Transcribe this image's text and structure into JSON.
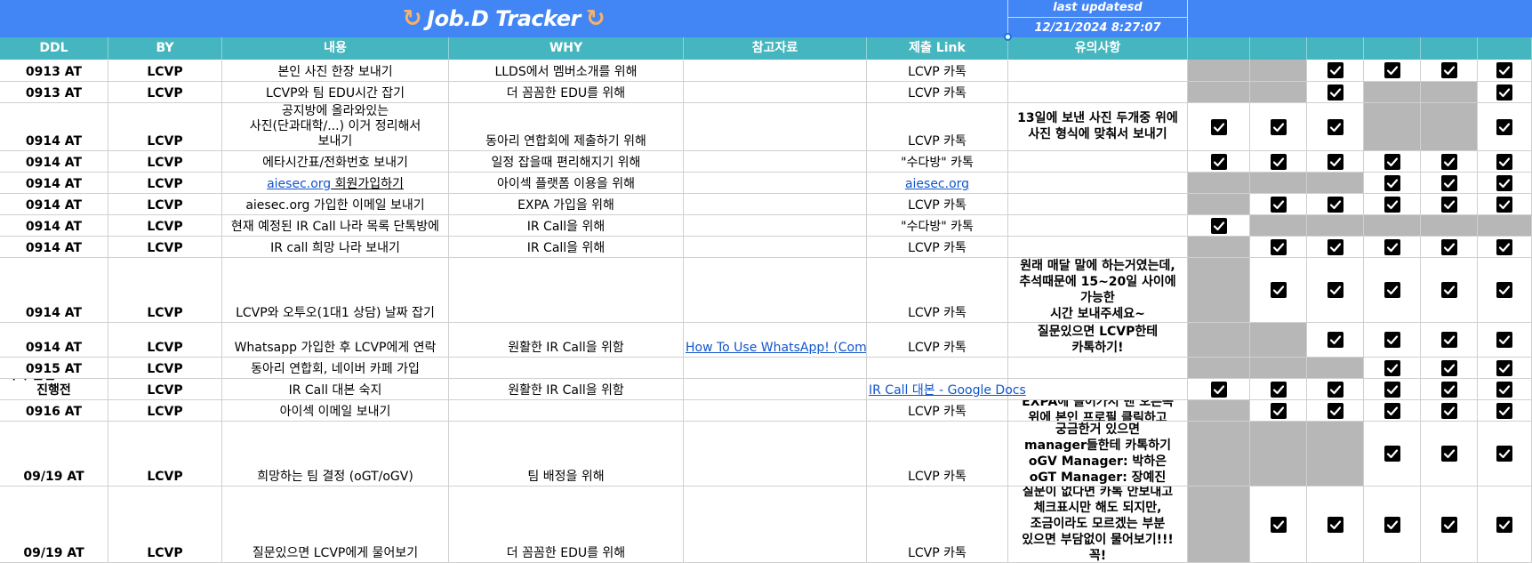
{
  "banner": {
    "title": "Job.D Tracker",
    "title_icon": "swirl-arrow-icon",
    "updated_label": "last updatesd",
    "updated_value": "12/21/2024 8:27:07"
  },
  "colors": {
    "banner": "#4285f4",
    "header": "#45b6bf",
    "gray_cell": "#b7b7b7",
    "link": "#1155cc"
  },
  "columns": [
    "DDL",
    "BY",
    "내용",
    "WHY",
    "참고자료",
    "제출 Link",
    "유의사항",
    "",
    "",
    "",
    "",
    "",
    ""
  ],
  "rows": [
    {
      "ddl": "0913 AT",
      "by": "LCVP",
      "content": "본인 사진 한장 보내기",
      "why": "LLDS에서 멤버소개를 위해",
      "ref": "",
      "link": "LCVP 카톡",
      "note": "",
      "checks": [
        "gray",
        "gray",
        "check",
        "check",
        "check",
        "check"
      ]
    },
    {
      "ddl": "0913 AT",
      "by": "LCVP",
      "content": "LCVP와 팀 EDU시간 잡기",
      "why": "더 꼼꼼한 EDU를 위해",
      "ref": "",
      "link": "LCVP 카톡",
      "note": "",
      "checks": [
        "gray",
        "gray",
        "check",
        "gray",
        "gray",
        "check"
      ]
    },
    {
      "ddl": "0914 AT",
      "by": "LCVP",
      "content": "공지방에 올라와있는\n사진(단과대학/...) 이거 정리해서\n보내기",
      "why": "동아리 연합회에 제출하기 위해",
      "ref": "",
      "link": "LCVP 카톡",
      "note": "13일에 보낸 사진 두개중 위에\n사진 형식에 맞춰서 보내기",
      "checks": [
        "check",
        "check",
        "check",
        "gray",
        "gray",
        "check"
      ]
    },
    {
      "ddl": "0914 AT",
      "by": "LCVP",
      "content": "에타시간표/전화번호 보내기",
      "why": "일정 잡을때 편리해지기 위해",
      "ref": "",
      "link": "\"수다방\" 카톡",
      "note": "",
      "checks": [
        "check",
        "check",
        "check",
        "check",
        "check",
        "check"
      ]
    },
    {
      "ddl": "0914 AT",
      "by": "LCVP",
      "content_link": "aiesec.org",
      "content": " 회원가입하기",
      "why": "아이섹 플랫폼 이용을 위해",
      "ref": "",
      "link_url": "aiesec.org",
      "link": "",
      "note": "",
      "checks": [
        "gray",
        "gray",
        "gray",
        "check",
        "check",
        "check"
      ]
    },
    {
      "ddl": "0914 AT",
      "by": "LCVP",
      "content": "aiesec.org 가입한 이메일 보내기",
      "why": "EXPA 가입을 위해",
      "ref": "",
      "link": "LCVP 카톡",
      "note": "",
      "checks": [
        "gray",
        "check",
        "check",
        "check",
        "check",
        "check"
      ]
    },
    {
      "ddl": "0914 AT",
      "by": "LCVP",
      "content": "현재 예정된 IR Call 나라 목록 단톡방에",
      "why": "IR Call을 위해",
      "ref": "",
      "link": "\"수다방\" 카톡",
      "note": "",
      "checks": [
        "check",
        "gray",
        "gray",
        "gray",
        "gray",
        "gray"
      ]
    },
    {
      "ddl": "0914 AT",
      "by": "LCVP",
      "content": "IR call 희망 나라 보내기",
      "why": "IR Call을 위해",
      "ref": "",
      "link": "LCVP 카톡",
      "note": "",
      "checks": [
        "gray",
        "check",
        "check",
        "check",
        "check",
        "check"
      ]
    },
    {
      "ddl": "0914 AT",
      "by": "LCVP",
      "content": "LCVP와 오투오(1대1 상담) 날짜 잡기",
      "why": "",
      "ref": "",
      "link": "LCVP 카톡",
      "note": "원래 매달 말에 하는거였는데,\n추석때문에 15~20일 사이에\n가능한\n시간 보내주세요~",
      "checks": [
        "gray",
        "check",
        "check",
        "check",
        "check",
        "check"
      ]
    },
    {
      "ddl": "0914 AT",
      "by": "LCVP",
      "content": "Whatsapp 가입한 후 LCVP에게 연락",
      "why": "원활한 IR Call을 위함",
      "ref": "How To Use WhatsApp! (Complete Beginners Guide)",
      "link": "LCVP 카톡",
      "note": "질문있으면 LCVP한테\n카톡하기!",
      "checks": [
        "gray",
        "gray",
        "check",
        "check",
        "check",
        "check"
      ]
    },
    {
      "ddl": "0915 AT",
      "by": "LCVP",
      "content": "동아리 연합회, 네이버 카페 가입",
      "why": "",
      "ref": "",
      "link": "",
      "note": "",
      "checks": [
        "gray",
        "gray",
        "gray",
        "check",
        "check",
        "check"
      ]
    },
    {
      "ddl": "각자 본인 IR call 진행전",
      "by": "LCVP",
      "content": "IR Call 대본 숙지",
      "why": "원활한 IR Call을 위함",
      "ref": "",
      "link_doc": "IR Call 대본 - Google Docs",
      "link": "",
      "note": "",
      "checks": [
        "check",
        "check",
        "check",
        "check",
        "check",
        "check"
      ]
    },
    {
      "ddl": "0916 AT",
      "by": "LCVP",
      "content": "아이섹 이메일 보내기",
      "why": "",
      "ref": "",
      "link": "LCVP 카톡",
      "note": "EXPA에 들어가서 맨 오른쪽\n위에 본인 프로필 클릭하고",
      "checks": [
        "gray",
        "check",
        "check",
        "check",
        "check",
        "check"
      ]
    },
    {
      "ddl": "09/19 AT",
      "by": "LCVP",
      "content": "희망하는 팀 결정 (oGT/oGV)",
      "why": "팀 배정을 위해",
      "ref": "",
      "link": "LCVP 카톡",
      "note": "궁금한거 있으면\nmanager들한테 카톡하기\noGV Manager: 박하은\noGT Manager: 장예진",
      "checks": [
        "gray",
        "gray",
        "gray",
        "check",
        "check",
        "check"
      ]
    },
    {
      "ddl": "09/19 AT",
      "by": "LCVP",
      "content": "질문있으면 LCVP에게 물어보기",
      "why": "더 꼼꼼한 EDU를 위해",
      "ref": "",
      "link": "LCVP 카톡",
      "note": "질문이 없다면 카톡 안보내고\n체크표시만 해도 되지만,\n조금이라도 모르겠는 부분\n있으면 부담없이 물어보기!!!\n꼭!",
      "checks": [
        "gray",
        "check",
        "check",
        "check",
        "check",
        "check"
      ]
    }
  ]
}
